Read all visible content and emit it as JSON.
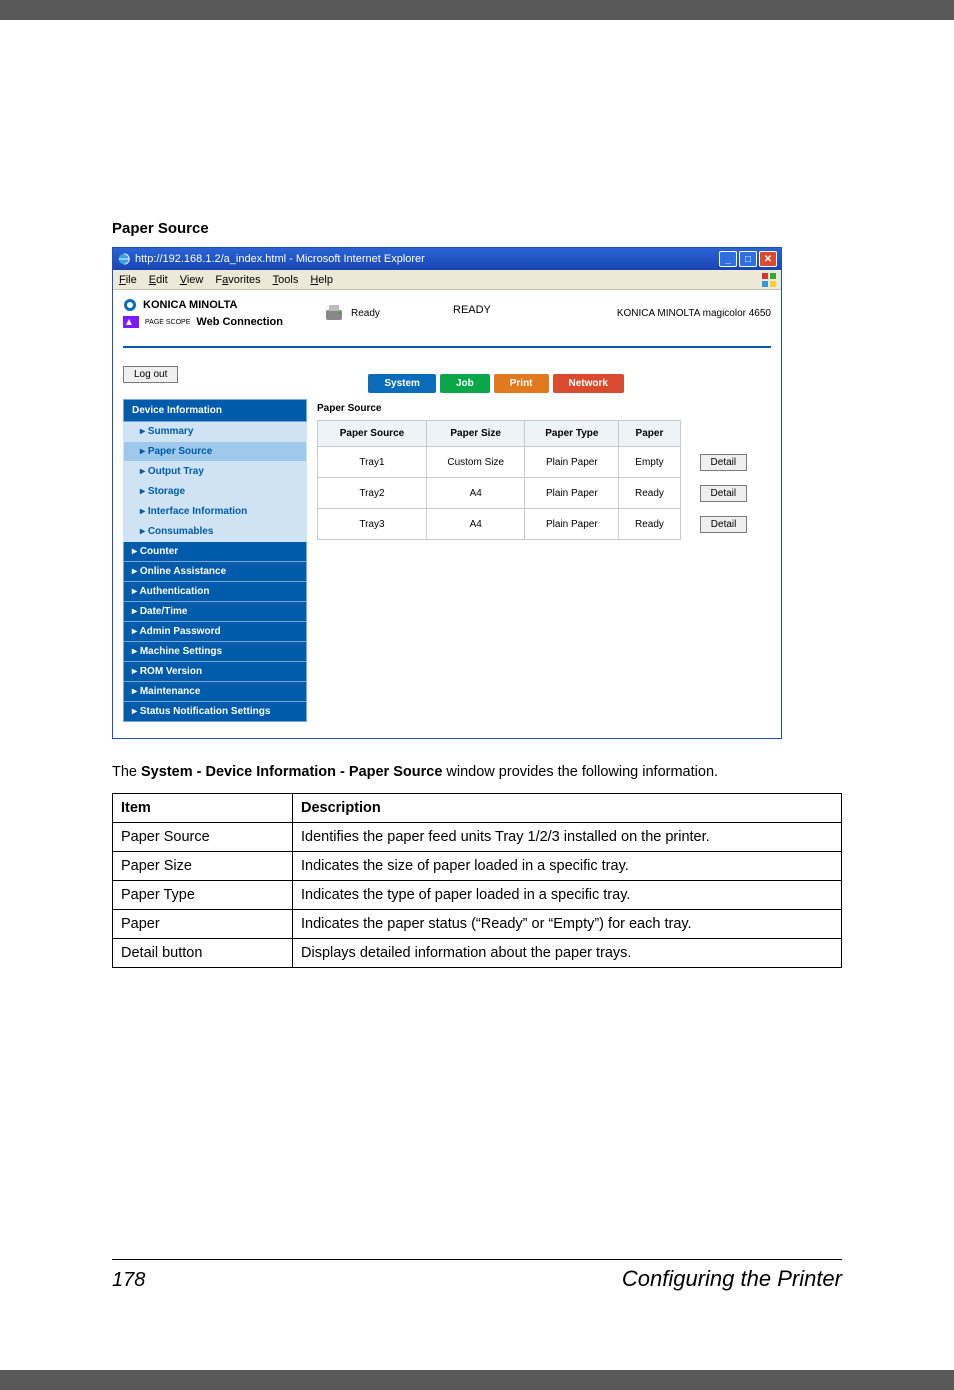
{
  "section_heading": "Paper Source",
  "browser": {
    "title": "http://192.168.1.2/a_index.html - Microsoft Internet Explorer",
    "menu": [
      "File",
      "Edit",
      "View",
      "Favorites",
      "Tools",
      "Help"
    ]
  },
  "header": {
    "brand1": "KONICA MINOLTA",
    "brand2_prefix": "PAGE SCOPE",
    "brand2": " Web Connection",
    "status_label": "Ready",
    "status_big": "READY",
    "right_label": "KONICA MINOLTA magicolor 4650"
  },
  "logout_label": "Log out",
  "tabs": {
    "system": "System",
    "job": "Job",
    "print": "Print",
    "network": "Network"
  },
  "sidebar": {
    "device_info": "Device Information",
    "subs": [
      "Summary",
      "Paper Source",
      "Output Tray",
      "Storage",
      "Interface Information",
      "Consumables"
    ],
    "items": [
      "Counter",
      "Online Assistance",
      "Authentication",
      "Date/Time",
      "Admin Password",
      "Machine Settings",
      "ROM Version",
      "Maintenance",
      "Status Notification Settings"
    ]
  },
  "panel": {
    "title": "Paper Source",
    "headers": [
      "Paper Source",
      "Paper Size",
      "Paper Type",
      "Paper"
    ],
    "rows": [
      {
        "source": "Tray1",
        "size": "Custom Size",
        "type": "Plain Paper",
        "paper": "Empty",
        "detail": "Detail"
      },
      {
        "source": "Tray2",
        "size": "A4",
        "type": "Plain Paper",
        "paper": "Ready",
        "detail": "Detail"
      },
      {
        "source": "Tray3",
        "size": "A4",
        "type": "Plain Paper",
        "paper": "Ready",
        "detail": "Detail"
      }
    ]
  },
  "body_text_prefix": "The ",
  "body_text_bold": "System - Device Information - Paper Source",
  "body_text_suffix": " window provides the following information.",
  "table": {
    "h1": "Item",
    "h2": "Description",
    "rows": [
      {
        "item": "Paper Source",
        "desc": "Identifies the paper feed units Tray 1/2/3 installed on the printer."
      },
      {
        "item": "Paper Size",
        "desc": "Indicates the size of paper loaded in a specific tray."
      },
      {
        "item": "Paper Type",
        "desc": "Indicates the type of paper loaded in a specific tray."
      },
      {
        "item": "Paper",
        "desc": "Indicates the paper status (“Ready” or “Empty”) for each tray."
      },
      {
        "item": "Detail button",
        "desc": "Displays detailed information about the paper trays."
      }
    ]
  },
  "footer": {
    "page": "178",
    "title": "Configuring the Printer"
  },
  "chart_data": {
    "type": "table",
    "title": "Item / Description",
    "columns": [
      "Item",
      "Description"
    ],
    "rows": [
      [
        "Paper Source",
        "Identifies the paper feed units Tray 1/2/3 installed on the printer."
      ],
      [
        "Paper Size",
        "Indicates the size of paper loaded in a specific tray."
      ],
      [
        "Paper Type",
        "Indicates the type of paper loaded in a specific tray."
      ],
      [
        "Paper",
        "Indicates the paper status (“Ready” or “Empty”) for each tray."
      ],
      [
        "Detail button",
        "Displays detailed information about the paper trays."
      ]
    ]
  }
}
